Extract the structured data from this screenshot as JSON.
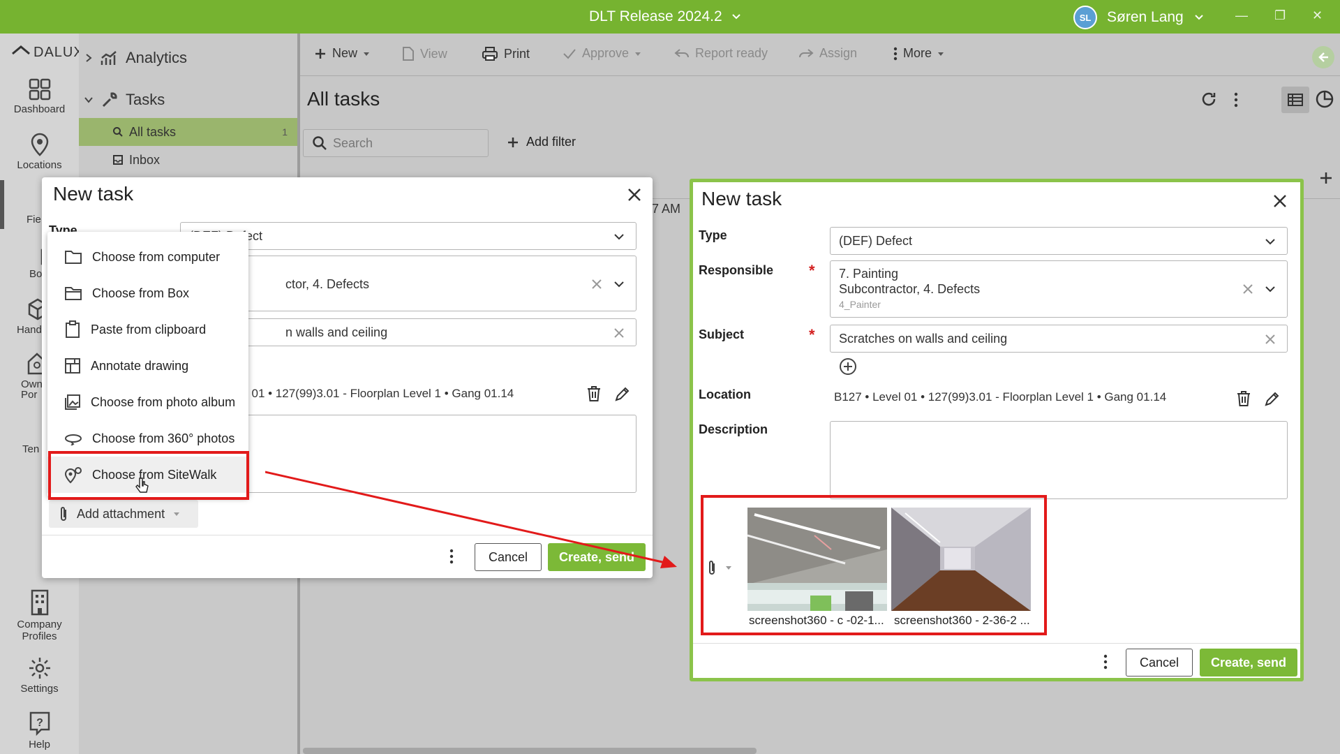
{
  "window": {
    "title": "DLT Release 2024.2",
    "user_initials": "SL",
    "user_name": "Søren Lang"
  },
  "rail": {
    "logo": "DALUX",
    "items": [
      {
        "label": "Dashboard",
        "icon": "grid-icon"
      },
      {
        "label": "Locations",
        "icon": "map-pin-icon"
      },
      {
        "label": "Fie",
        "icon": "field-icon"
      },
      {
        "label": "Bo",
        "icon": "box-icon"
      },
      {
        "label": "Hand",
        "icon": "handover-icon"
      },
      {
        "label": "Own",
        "sub": "Por",
        "icon": "owner-portal-icon"
      },
      {
        "label": "Ten",
        "icon": "tender-icon"
      },
      {
        "label": "Company",
        "sub": "Profiles",
        "icon": "building-icon"
      },
      {
        "label": "Settings",
        "icon": "gear-icon"
      },
      {
        "label": "Help",
        "icon": "help-icon"
      }
    ]
  },
  "sidenav": {
    "analytics": "Analytics",
    "tasks": "Tasks",
    "all_tasks": "All tasks",
    "all_tasks_count": "1",
    "inbox": "Inbox"
  },
  "toolbar": {
    "new": "New",
    "view": "View",
    "print": "Print",
    "approve": "Approve",
    "report_ready": "Report ready",
    "assign": "Assign",
    "more": "More"
  },
  "main": {
    "title": "All tasks",
    "search_placeholder": "Search",
    "add_filter": "Add filter",
    "bg_time": "7 AM"
  },
  "left_dialog": {
    "title": "New task",
    "type_label": "Type",
    "type_value": "(DEF) Defect",
    "responsible_value": "ctor, 4. Defects",
    "subject_value": "n walls and ceiling",
    "location_value": "l 01 • 127(99)3.01 - Floorplan Level 1 • Gang 01.14",
    "add_attachment": "Add attachment",
    "cancel": "Cancel",
    "create": "Create, send"
  },
  "menu": {
    "items": [
      {
        "label": "Choose from computer",
        "icon": "folder-icon"
      },
      {
        "label": "Choose from Box",
        "icon": "box-folder-icon"
      },
      {
        "label": "Paste from clipboard",
        "icon": "clipboard-icon"
      },
      {
        "label": "Annotate drawing",
        "icon": "drawing-icon"
      },
      {
        "label": "Choose from photo album",
        "icon": "photo-icon"
      },
      {
        "label": "Choose from 360° photos",
        "icon": "360-icon"
      },
      {
        "label": "Choose from SiteWalk",
        "icon": "sitewalk-icon"
      }
    ]
  },
  "right_dialog": {
    "title": "New task",
    "type_label": "Type",
    "type_value": "(DEF) Defect",
    "responsible_label": "Responsible",
    "responsible_line1": "7. Painting",
    "responsible_line2": "Subcontractor, 4. Defects",
    "responsible_line3": "4_Painter",
    "subject_label": "Subject",
    "subject_value": "Scratches on walls and ceiling",
    "location_label": "Location",
    "location_value": "B127 • Level 01 • 127(99)3.01 - Floorplan Level 1 • Gang 01.14",
    "description_label": "Description",
    "attachments": [
      {
        "caption": "screenshot360 - c -02-1..."
      },
      {
        "caption": "screenshot360 - 2-36-2 ..."
      }
    ],
    "cancel": "Cancel",
    "create": "Create, send"
  },
  "colors": {
    "brand_green": "#76b330",
    "button_green": "#7cb937",
    "highlight_red": "#e21a1a",
    "required_red": "#d32020"
  }
}
